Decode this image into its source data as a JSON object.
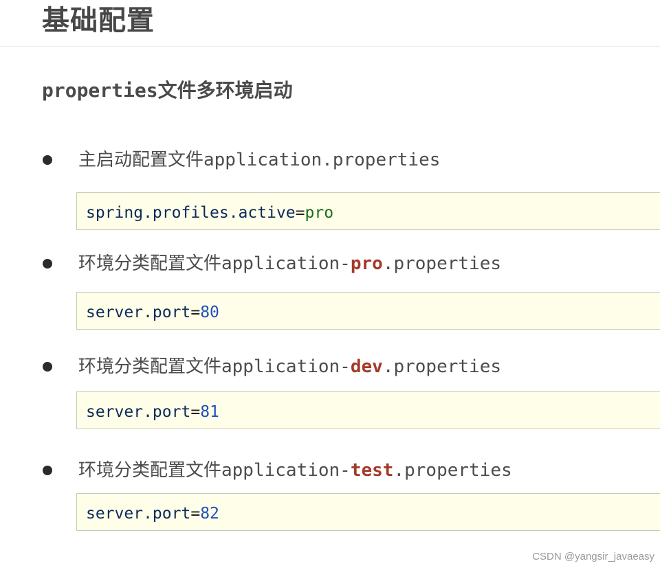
{
  "page": {
    "title": "基础配置",
    "subtitle": "properties文件多环境启动"
  },
  "items": [
    {
      "label_prefix": "主启动配置文件application.properties",
      "label_highlight": "",
      "label_suffix": "",
      "code": {
        "key": "spring.profiles.active",
        "op": "=",
        "value": "pro",
        "value_type": "string"
      }
    },
    {
      "label_prefix": "环境分类配置文件application-",
      "label_highlight": "pro",
      "label_suffix": ".properties",
      "code": {
        "key": "server.port",
        "op": "=",
        "value": "80",
        "value_type": "number"
      }
    },
    {
      "label_prefix": "环境分类配置文件application-",
      "label_highlight": "dev",
      "label_suffix": ".properties",
      "code": {
        "key": "server.port",
        "op": "=",
        "value": "81",
        "value_type": "number"
      }
    },
    {
      "label_prefix": "环境分类配置文件application-",
      "label_highlight": "test",
      "label_suffix": ".properties",
      "code": {
        "key": "server.port",
        "op": "=",
        "value": "82",
        "value_type": "number"
      }
    }
  ],
  "colors": {
    "highlight": "#a33a2a",
    "code_background": "#fffee8",
    "code_key": "#0b2a5a",
    "string_value": "#1a6e1a",
    "number_value": "#1f4fc0"
  },
  "watermark": "CSDN @yangsir_javaeasy"
}
